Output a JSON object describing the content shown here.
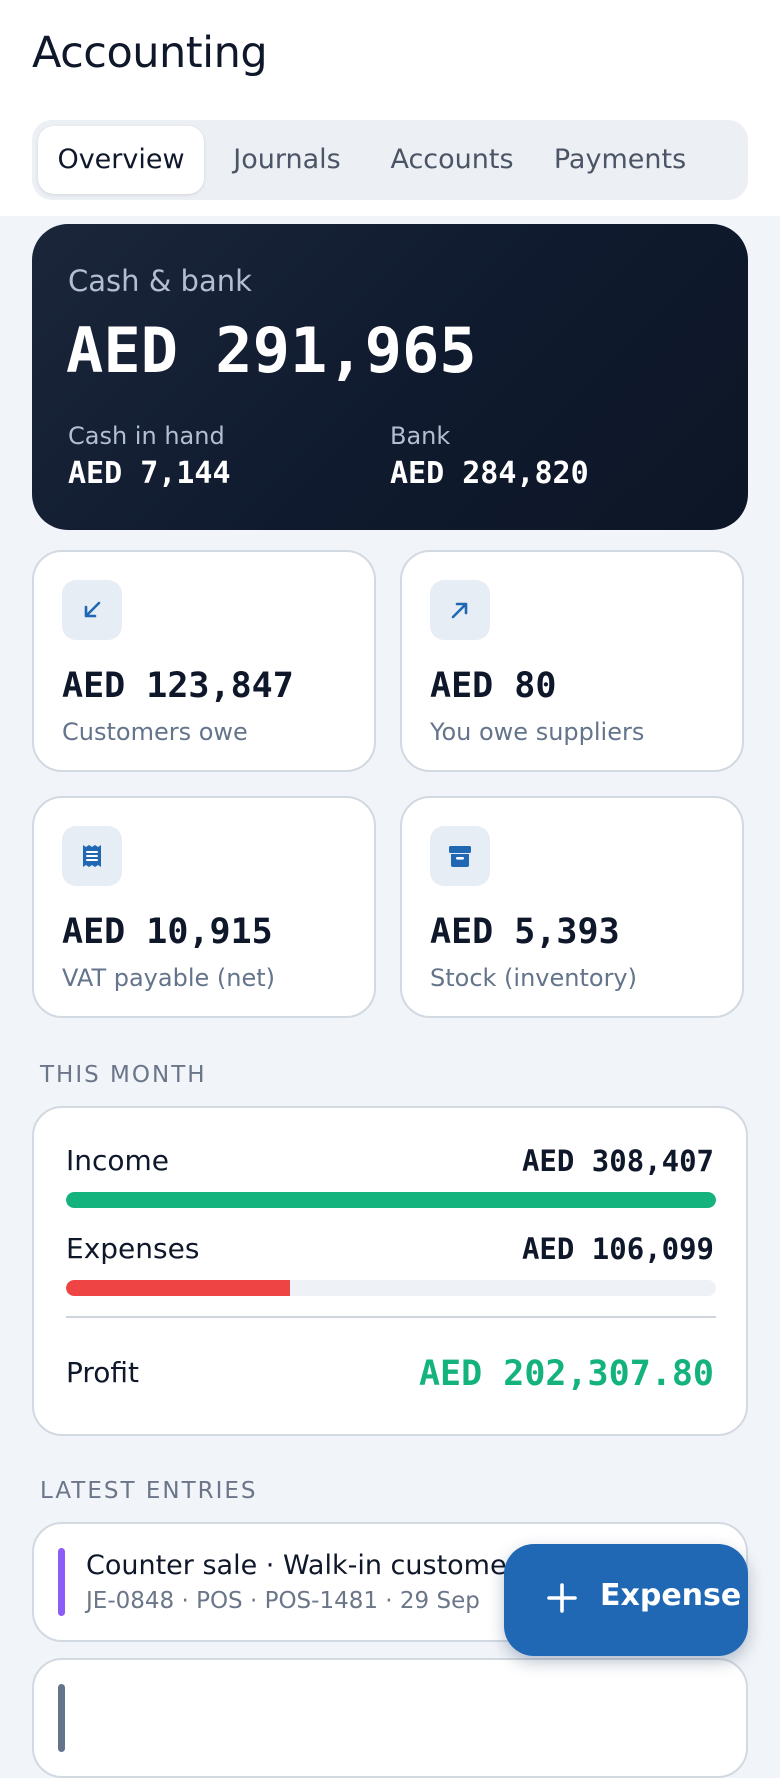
{
  "header": {
    "title": "Accounting",
    "tabs": [
      "Overview",
      "Journals",
      "Accounts",
      "Payments"
    ]
  },
  "cash_bank": {
    "label": "Cash & bank",
    "total": "AED 291,965",
    "cash_label": "Cash in hand",
    "cash_value": "AED 7,144",
    "bank_label": "Bank",
    "bank_value": "AED 284,820"
  },
  "stats": [
    {
      "value": "AED 123,847",
      "label": "Customers owe",
      "icon": "arrow-down-left-icon"
    },
    {
      "value": "AED 80",
      "label": "You owe suppliers",
      "icon": "arrow-up-right-icon"
    },
    {
      "value": "AED 10,915",
      "label": "VAT payable (net)",
      "icon": "receipt-icon"
    },
    {
      "value": "AED 5,393",
      "label": "Stock (inventory)",
      "icon": "archive-box-icon"
    }
  ],
  "this_month": {
    "heading": "THIS MONTH",
    "income_label": "Income",
    "income_value": "AED 308,407",
    "income_fraction": 1.0,
    "expenses_label": "Expenses",
    "expenses_value": "AED 106,099",
    "expenses_fraction": 0.344,
    "profit_label": "Profit",
    "profit_value": "AED 202,307.80"
  },
  "latest_entries": {
    "heading": "LATEST ENTRIES",
    "items": [
      {
        "title": "Counter sale · Walk-in customer",
        "meta": "JE-0848 · POS · POS-1481 · 29 Sep"
      }
    ]
  },
  "fab": {
    "label": "Expense",
    "icon": "plus-icon"
  },
  "colors": {
    "accent": "#2067b4",
    "income": "#14b37d",
    "expenses": "#ef4444",
    "profit": "#14b37d",
    "entry_accent": "#8b5cf6",
    "dark_card": "#0f1a2e"
  }
}
